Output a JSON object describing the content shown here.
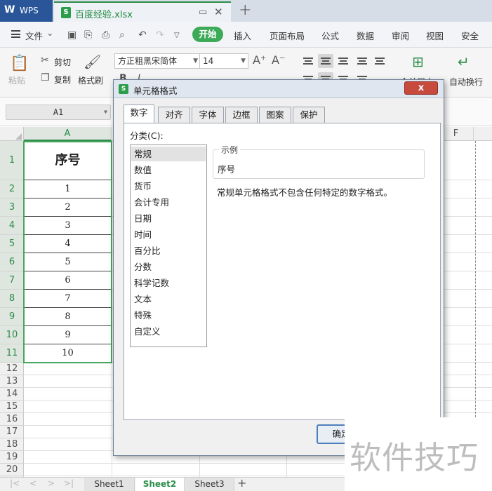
{
  "titlebar": {
    "app_name": "WPS",
    "file_name": "百度经验.xlsx",
    "new_tab": "+"
  },
  "menubar": {
    "file_label": "文件",
    "file_arrow": "⌄",
    "start_label": "开始",
    "items": [
      "插入",
      "页面布局",
      "公式",
      "数据",
      "审阅",
      "视图",
      "安全"
    ]
  },
  "ribbon": {
    "paste_label": "粘贴",
    "cut_label": "剪切",
    "copy_label": "复制",
    "format_painter_label": "格式刷",
    "font_name": "方正粗黑宋简体",
    "font_size": "14",
    "increase_font": "A⁺",
    "decrease_font": "A⁻",
    "merge_center_label": "合并居中",
    "wrap_text_label": "自动换行"
  },
  "formula_bar": {
    "name_box": "A1"
  },
  "grid": {
    "column_a": "A",
    "column_f": "F",
    "rows": [
      "1",
      "2",
      "3",
      "4",
      "5",
      "6",
      "7",
      "8",
      "9",
      "10",
      "11",
      "12",
      "13",
      "14",
      "15",
      "16",
      "17",
      "18",
      "19",
      "20"
    ],
    "a_values": [
      "序号",
      "1",
      "2",
      "3",
      "4",
      "5",
      "6",
      "7",
      "8",
      "9",
      "10"
    ]
  },
  "sheets": {
    "tabs": [
      "Sheet1",
      "Sheet2",
      "Sheet3"
    ],
    "active": "Sheet2",
    "add": "+"
  },
  "dialog": {
    "title": "单元格格式",
    "close": "x",
    "tabs": [
      "数字",
      "对齐",
      "字体",
      "边框",
      "图案",
      "保护"
    ],
    "active_tab": "数字",
    "category_label": "分类(C):",
    "categories": [
      "常规",
      "数值",
      "货币",
      "会计专用",
      "日期",
      "时间",
      "百分比",
      "分数",
      "科学记数",
      "文本",
      "特殊",
      "自定义"
    ],
    "selected_category": "常规",
    "sample_label": "示例",
    "sample_value": "序号",
    "description": "常规单元格格式不包含任何特定的数字格式。",
    "ok_label": "确定"
  },
  "watermark": "软件技巧",
  "colors": {
    "accent_green": "#2c8e4a",
    "wps_blue": "#2a5699",
    "close_red": "#c74a3d"
  }
}
